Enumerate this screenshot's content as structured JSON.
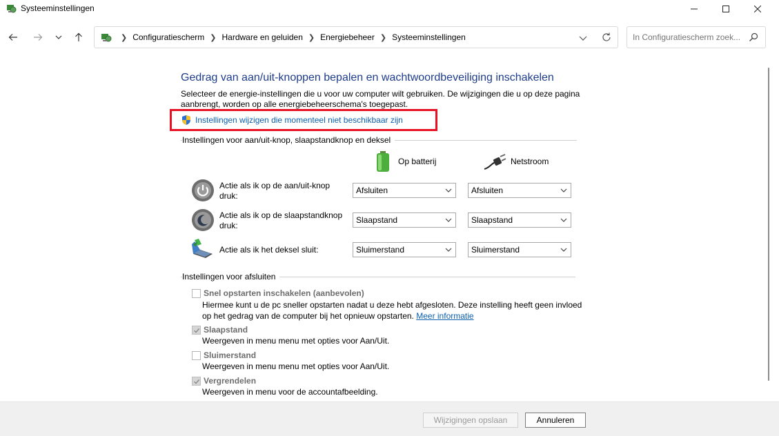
{
  "window": {
    "title": "Systeeminstellingen"
  },
  "nav": {
    "breadcrumbs": [
      "Configuratiescherm",
      "Hardware en geluiden",
      "Energiebeheer",
      "Systeeminstellingen"
    ],
    "search_placeholder": "In Configuratiescherm zoek..."
  },
  "main": {
    "heading": "Gedrag van aan/uit-knoppen bepalen en wachtwoordbeveiliging inschakelen",
    "intro": "Selecteer de energie-instellingen die u voor uw computer wilt gebruiken. De wijzigingen die u op deze pagina aanbrengt, worden op alle energiebeheerschema's toegepast.",
    "change_link": "Instellingen wijzigen die momenteel niet beschikbaar zijn",
    "highlight_color": "#e81123"
  },
  "power_buttons": {
    "section_title": "Instellingen voor aan/uit-knop, slaapstandknop en deksel",
    "col_battery": "Op batterij",
    "col_ac": "Netstroom",
    "rows": [
      {
        "label": "Actie als ik op de aan/uit-knop druk:",
        "battery": "Afsluiten",
        "ac": "Afsluiten"
      },
      {
        "label": "Actie als ik op de slaapstandknop druk:",
        "battery": "Slaapstand",
        "ac": "Slaapstand"
      },
      {
        "label": "Actie als ik het deksel sluit:",
        "battery": "Sluimerstand",
        "ac": "Sluimerstand"
      }
    ]
  },
  "shutdown": {
    "section_title": "Instellingen voor afsluiten",
    "items": [
      {
        "label": "Snel opstarten inschakelen (aanbevolen)",
        "checked": false,
        "desc": "Hiermee kunt u de pc sneller opstarten nadat u deze hebt afgesloten. Deze instelling heeft geen invloed op het gedrag van de computer bij het opnieuw opstarten.",
        "link": "Meer informatie"
      },
      {
        "label": "Slaapstand",
        "checked": true,
        "desc": "Weergeven in menu menu met opties voor Aan/Uit."
      },
      {
        "label": "Sluimerstand",
        "checked": false,
        "desc": "Weergeven in menu menu met opties voor Aan/Uit."
      },
      {
        "label": "Vergrendelen",
        "checked": true,
        "desc": "Weergeven in menu voor de accountafbeelding."
      }
    ]
  },
  "footer": {
    "save_label": "Wijzigingen opslaan",
    "cancel_label": "Annuleren"
  }
}
